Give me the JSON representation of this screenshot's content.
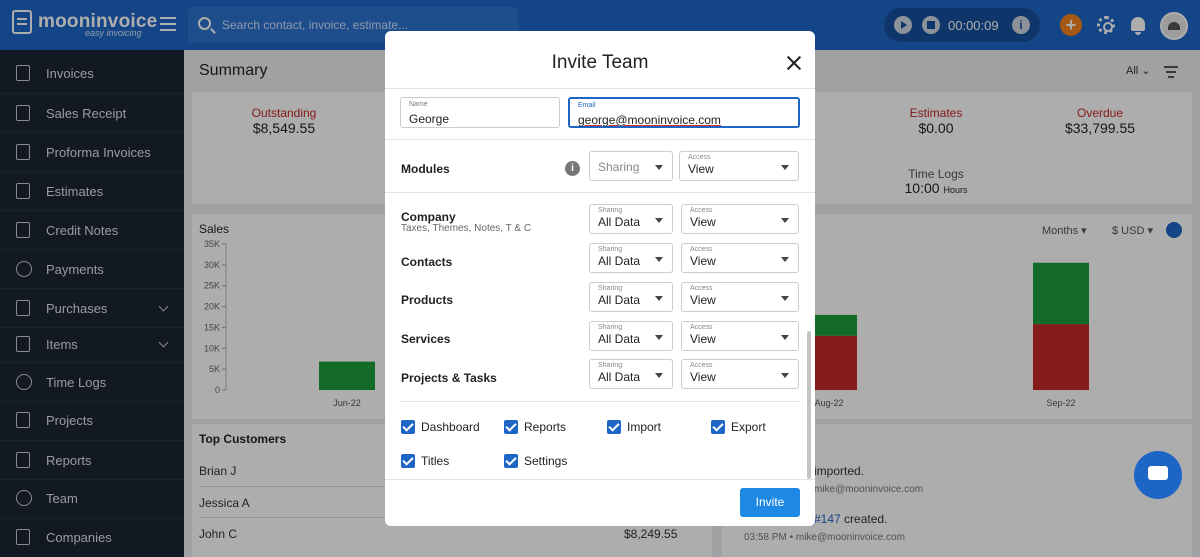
{
  "topbar": {
    "logo_text": "mooninvoice",
    "logo_sub": "easy invoicing",
    "search_placeholder": "Search contact, invoice, estimate...",
    "timer": "00:00:09"
  },
  "sidebar": {
    "items": [
      {
        "label": "Invoices"
      },
      {
        "label": "Sales Receipt"
      },
      {
        "label": "Proforma Invoices"
      },
      {
        "label": "Estimates"
      },
      {
        "label": "Credit Notes"
      },
      {
        "label": "Payments"
      },
      {
        "label": "Purchases"
      },
      {
        "label": "Items"
      },
      {
        "label": "Time Logs"
      },
      {
        "label": "Projects"
      },
      {
        "label": "Reports"
      },
      {
        "label": "Team"
      },
      {
        "label": "Companies"
      }
    ]
  },
  "summary": {
    "title": "Summary",
    "filter": "All",
    "outstanding_label": "Outstanding",
    "outstanding_value": "$8,549.55",
    "estimates_label": "Estimates",
    "estimates_value": "$0.00",
    "overdue_label": "Overdue",
    "overdue_value": "$33,799.55",
    "timelogs_label": "Time Logs",
    "timelogs_value": "10:00",
    "timelogs_unit": "Hours"
  },
  "sales": {
    "title": "Sales",
    "period": "Months",
    "currency": "$ USD"
  },
  "chart_data": {
    "type": "bar",
    "categories": [
      "Jun-22",
      "Aug-22",
      "Sep-22"
    ],
    "y_ticks": [
      "35K",
      "30K",
      "25K",
      "20K",
      "15K",
      "10K",
      "5K",
      "0"
    ],
    "ylim": [
      0,
      35000
    ],
    "series": [
      {
        "color": "#c62828",
        "values": [
          0,
          13000,
          15800
        ]
      },
      {
        "color": "#1e9e3c",
        "values": [
          6800,
          5000,
          14700
        ]
      }
    ]
  },
  "customers": {
    "title": "Top Customers",
    "rows": [
      "Brian J",
      "Jessica A",
      "John C"
    ],
    "amount": "$8,249.55"
  },
  "activity": {
    "line1": "imported.",
    "line1_sub": "mike@mooninvoice.com",
    "line2_link": "#147",
    "line2": "created.",
    "line2_sub": "03:58 PM • mike@mooninvoice.com"
  },
  "modal": {
    "title": "Invite Team",
    "name_label": "Name",
    "name_value": "George",
    "email_label": "Email",
    "email_value": "george@mooninvoice.com",
    "modules_label": "Modules",
    "sharing_label": "Sharing",
    "access_label": "Access",
    "header_sharing_value": "Sharing",
    "header_access_value": "View",
    "modules": [
      {
        "name": "Company",
        "sub": "Taxes, Themes, Notes, T & C",
        "sharing": "All Data",
        "access": "View"
      },
      {
        "name": "Contacts",
        "sub": "",
        "sharing": "All Data",
        "access": "View"
      },
      {
        "name": "Products",
        "sub": "",
        "sharing": "All Data",
        "access": "View"
      },
      {
        "name": "Services",
        "sub": "",
        "sharing": "All Data",
        "access": "View"
      },
      {
        "name": "Projects & Tasks",
        "sub": "",
        "sharing": "All Data",
        "access": "View"
      }
    ],
    "permissions": [
      "Dashboard",
      "Reports",
      "Import",
      "Export",
      "Titles",
      "Settings"
    ],
    "invite_label": "Invite"
  },
  "colors": {
    "primary": "#1e66c6",
    "sidebar": "#1c2634",
    "danger": "#c62828",
    "success": "#1e9e3c"
  }
}
